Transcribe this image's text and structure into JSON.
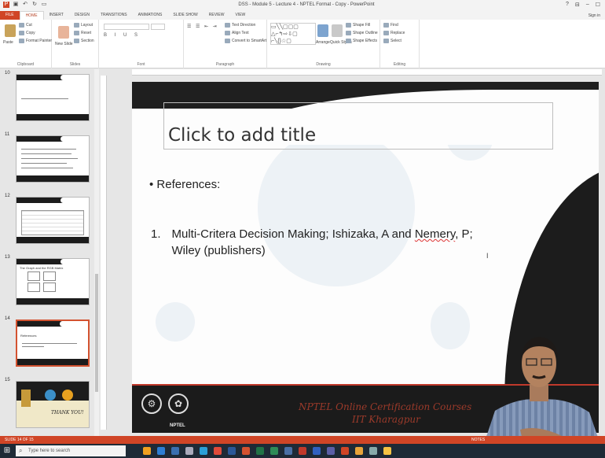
{
  "window": {
    "title": "DSS - Module 5 - Lecture 4 - NPTEL Format - Copy - PowerPoint",
    "controls": [
      "?",
      "⊟",
      "–",
      "☐"
    ]
  },
  "tabs": [
    "FILE",
    "HOME",
    "INSERT",
    "DESIGN",
    "TRANSITIONS",
    "ANIMATIONS",
    "SLIDE SHOW",
    "REVIEW",
    "VIEW"
  ],
  "active_tab": "HOME",
  "sign_in": "Sign in",
  "ribbon": {
    "clipboard": {
      "label": "Clipboard",
      "paste": "Paste",
      "cut": "Cut",
      "copy": "Copy",
      "format_painter": "Format Painter"
    },
    "slides": {
      "label": "Slides",
      "new_slide": "New Slide",
      "layout": "Layout",
      "reset": "Reset",
      "section": "Section"
    },
    "font": {
      "label": "Font"
    },
    "paragraph": {
      "label": "Paragraph",
      "text_direction": "Text Direction",
      "align_text": "Align Text",
      "convert_smartart": "Convert to SmartArt"
    },
    "drawing": {
      "label": "Drawing",
      "arrange": "Arrange",
      "quick_styles": "Quick Styles",
      "shape_fill": "Shape Fill",
      "shape_outline": "Shape Outline",
      "shape_effects": "Shape Effects"
    },
    "editing": {
      "label": "Editing",
      "find": "Find",
      "replace": "Replace",
      "select": "Select"
    }
  },
  "thumbnails": [
    {
      "num": "10"
    },
    {
      "num": "11"
    },
    {
      "num": "12"
    },
    {
      "num": "13",
      "heading": "The Graph and the RGB Matrix"
    },
    {
      "num": "14",
      "heading": "References"
    },
    {
      "num": "15",
      "thanks": "THANK YOU!"
    }
  ],
  "slide": {
    "title_placeholder": "Click to add title",
    "bullet": "• References:",
    "ref_number": "1.",
    "ref_text_a": "Multi-Critera Decision Making; Ishizaka, A and ",
    "ref_text_b": "Nemery",
    "ref_text_c": ", P; Wiley (publishers)",
    "footer_title": "NPTEL Online Certification Courses",
    "footer_sub": "IIT Kharagpur",
    "nptel_label": "NPTEL"
  },
  "status": {
    "slide_indicator": "SLIDE 14 OF 15",
    "notes": "NOTES"
  },
  "taskbar": {
    "search_placeholder": "Type here to search"
  },
  "colors": {
    "accent": "#d04526",
    "slide_dark": "#1c1c1c",
    "footer_text": "#9c3a2a"
  }
}
